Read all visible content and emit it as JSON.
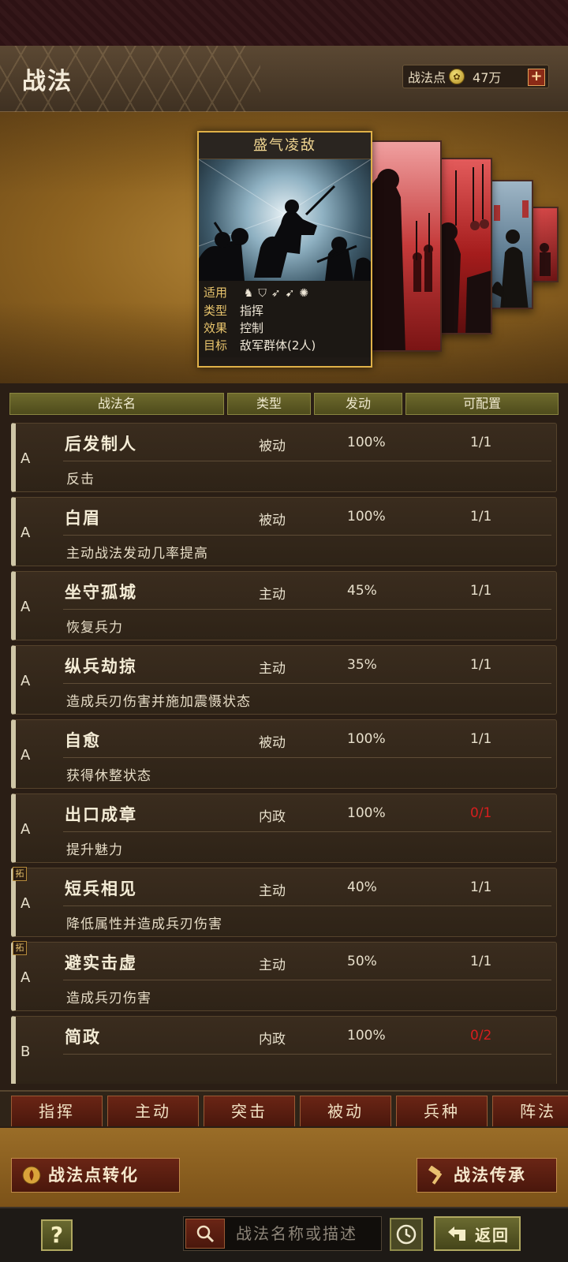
{
  "header": {
    "title": "战法",
    "points_label": "战法点",
    "points_value": "47万",
    "plus": "+"
  },
  "featured": {
    "name": "盛气凌敌",
    "info": [
      {
        "key": "适用",
        "value": ""
      },
      {
        "key": "类型",
        "value": "指挥"
      },
      {
        "key": "效果",
        "value": "控制"
      },
      {
        "key": "目标",
        "value": "敌军群体(2人)"
      }
    ]
  },
  "table": {
    "headers": [
      "战法名",
      "类型",
      "发动",
      "可配置"
    ],
    "rows": [
      {
        "grade": "A",
        "name": "后发制人",
        "type": "被动",
        "rate": "100%",
        "conf": "1/1",
        "desc": "反击",
        "tag": ""
      },
      {
        "grade": "A",
        "name": "白眉",
        "type": "被动",
        "rate": "100%",
        "conf": "1/1",
        "desc": "主动战法发动几率提高",
        "tag": ""
      },
      {
        "grade": "A",
        "name": "坐守孤城",
        "type": "主动",
        "rate": "45%",
        "conf": "1/1",
        "desc": "恢复兵力",
        "tag": ""
      },
      {
        "grade": "A",
        "name": "纵兵劫掠",
        "type": "主动",
        "rate": "35%",
        "conf": "1/1",
        "desc": "造成兵刃伤害并施加震慑状态",
        "tag": ""
      },
      {
        "grade": "A",
        "name": "自愈",
        "type": "被动",
        "rate": "100%",
        "conf": "1/1",
        "desc": "获得休整状态",
        "tag": ""
      },
      {
        "grade": "A",
        "name": "出口成章",
        "type": "内政",
        "rate": "100%",
        "conf": "0/1",
        "desc": "提升魅力",
        "tag": ""
      },
      {
        "grade": "A",
        "name": "短兵相见",
        "type": "主动",
        "rate": "40%",
        "conf": "1/1",
        "desc": "降低属性并造成兵刃伤害",
        "tag": "拓"
      },
      {
        "grade": "A",
        "name": "避实击虚",
        "type": "主动",
        "rate": "50%",
        "conf": "1/1",
        "desc": "造成兵刃伤害",
        "tag": "拓"
      },
      {
        "grade": "B",
        "name": "简政",
        "type": "内政",
        "rate": "100%",
        "conf": "0/2",
        "desc": "",
        "tag": ""
      }
    ]
  },
  "filters": [
    "指挥",
    "主动",
    "突击",
    "被动",
    "兵种",
    "阵法"
  ],
  "actions": {
    "convert": "战法点转化",
    "inherit": "战法传承"
  },
  "footer": {
    "help": "?",
    "search_placeholder": "战法名称或描述",
    "back": "返回"
  },
  "colors": {
    "accent_gold": "#e0b148",
    "unavailable_red": "#d61e1e",
    "button_red": "#6a2515"
  }
}
